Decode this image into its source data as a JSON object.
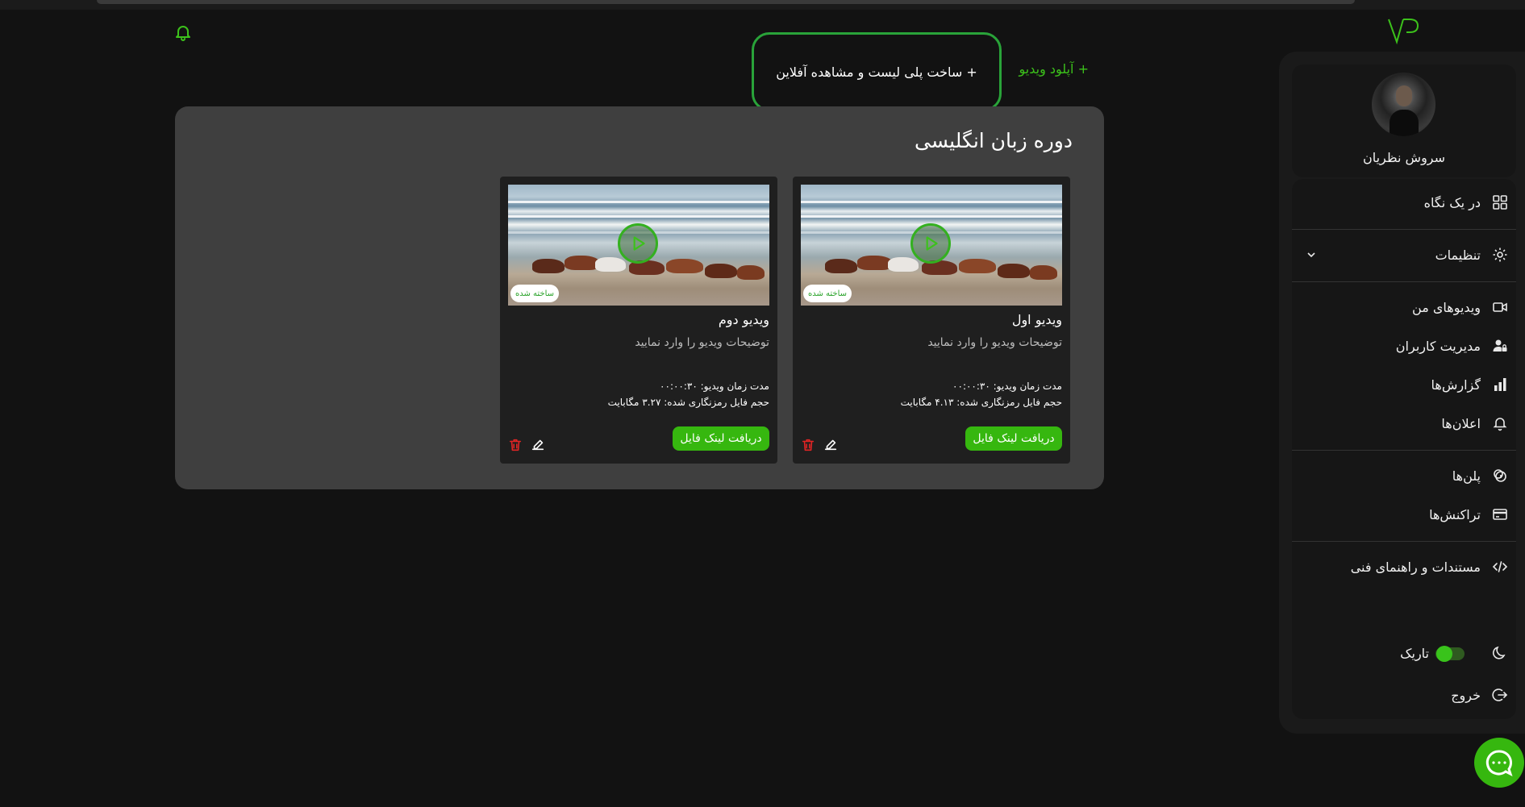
{
  "header": {
    "upload_label": "+ آپلود ویدیو",
    "playlist_label": "+ ساخت پلی لیست و مشاهده آفلاین"
  },
  "sidebar": {
    "user_name": "سروش نظریان",
    "items": [
      {
        "label": "در یک نگاه",
        "icon": "dashboard-grid-icon"
      },
      {
        "label": "تنظیمات",
        "icon": "gear-icon"
      },
      {
        "label": "ویدیوهای من",
        "icon": "video-camera-icon"
      },
      {
        "label": "مدیریت کاربران",
        "icon": "user-lock-icon"
      },
      {
        "label": "گزارش‌ها",
        "icon": "bar-chart-icon"
      },
      {
        "label": "اعلان‌ها",
        "icon": "bell-icon"
      },
      {
        "label": "پلن‌ها",
        "icon": "coins-icon"
      },
      {
        "label": "تراکنش‌ها",
        "icon": "credit-card-icon"
      },
      {
        "label": "مستندات و راهنمای فنی",
        "icon": "code-icon"
      }
    ],
    "theme_label": "تاریک",
    "theme_dark_on": true,
    "logout_label": "خروج"
  },
  "course": {
    "title": "دوره زبان انگلیسی",
    "videos": [
      {
        "title": "ویدیو اول",
        "description": "توضیحات ویدیو را وارد نمایید",
        "status": "ساخته شده",
        "duration_line": "مدت زمان ویدیو: ۰۰:۰۰:۳۰",
        "size_line": "حجم فایل رمزنگاری شده: ۴.۱۳ مگابایت",
        "link_button": "دریافت لینک فایل"
      },
      {
        "title": "ویدیو دوم",
        "description": "توضیحات ویدیو را وارد نمایید",
        "status": "ساخته شده",
        "duration_line": "مدت زمان ویدیو: ۰۰:۰۰:۳۰",
        "size_line": "حجم فایل رمزنگاری شده: ۳.۲۷ مگابایت",
        "link_button": "دریافت لینک فایل"
      }
    ]
  },
  "colors": {
    "accent": "#36b70f",
    "background": "#121212",
    "panel": "#3f3f3f",
    "danger": "#e02424"
  }
}
